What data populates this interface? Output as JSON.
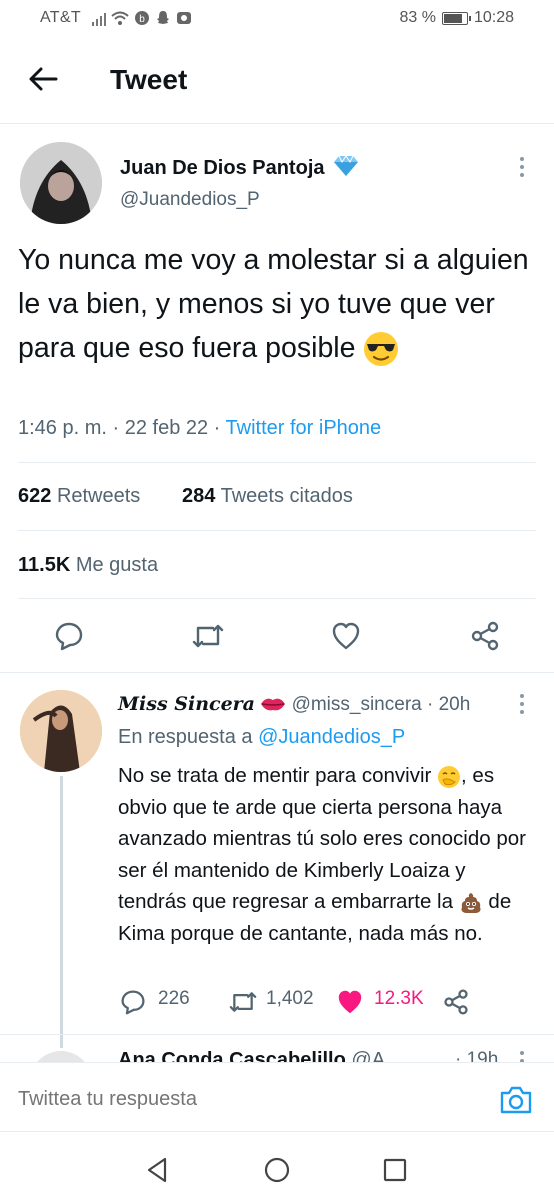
{
  "status": {
    "carrier": "AT&T",
    "battery": "83 %",
    "battery_level": 0.83,
    "time": "10:28"
  },
  "header": {
    "title": "Tweet"
  },
  "tweet": {
    "name": "Juan De Dios Pantoja",
    "handle": "@Juandedios_P",
    "text": "Yo nunca me voy a molestar si a alguien le va bien, y menos si yo tuve que ver para que eso fuera posible",
    "time": "1:46 p. m. · 22 feb 22 · ",
    "source": "Twitter for iPhone",
    "retweets_count": "622",
    "retweets_label": "Retweets",
    "quotes_count": "284",
    "quotes_label": "Tweets citados",
    "likes_count": "11.5K",
    "likes_label": "Me gusta"
  },
  "reply": {
    "name": "Miss Sincera",
    "handle": "@miss_sincera",
    "age": "· 20h",
    "reply_to_label": "En respuesta a",
    "reply_to_handle": "@Juandedios_P",
    "text_1": "No se trata de mentir para convivir",
    "text_2": ", es obvio que te arde que cierta persona haya avanzado mientras tú solo eres conocido por ser él mantenido de Kimberly Loaiza y tendrás que regresar a embarrarte la",
    "text_3": "de Kima porque de cantante, nada más no.",
    "replies": "226",
    "retweets": "1,402",
    "likes": "12.3K"
  },
  "next_reply": {
    "name": "Ana Conda Cascabelillo",
    "handle": "@A...",
    "age": "· 19h"
  },
  "compose": {
    "placeholder": "Twittea tu respuesta"
  },
  "colors": {
    "accent": "#1d9bf0",
    "like": "#f91880",
    "muted": "#536471"
  }
}
